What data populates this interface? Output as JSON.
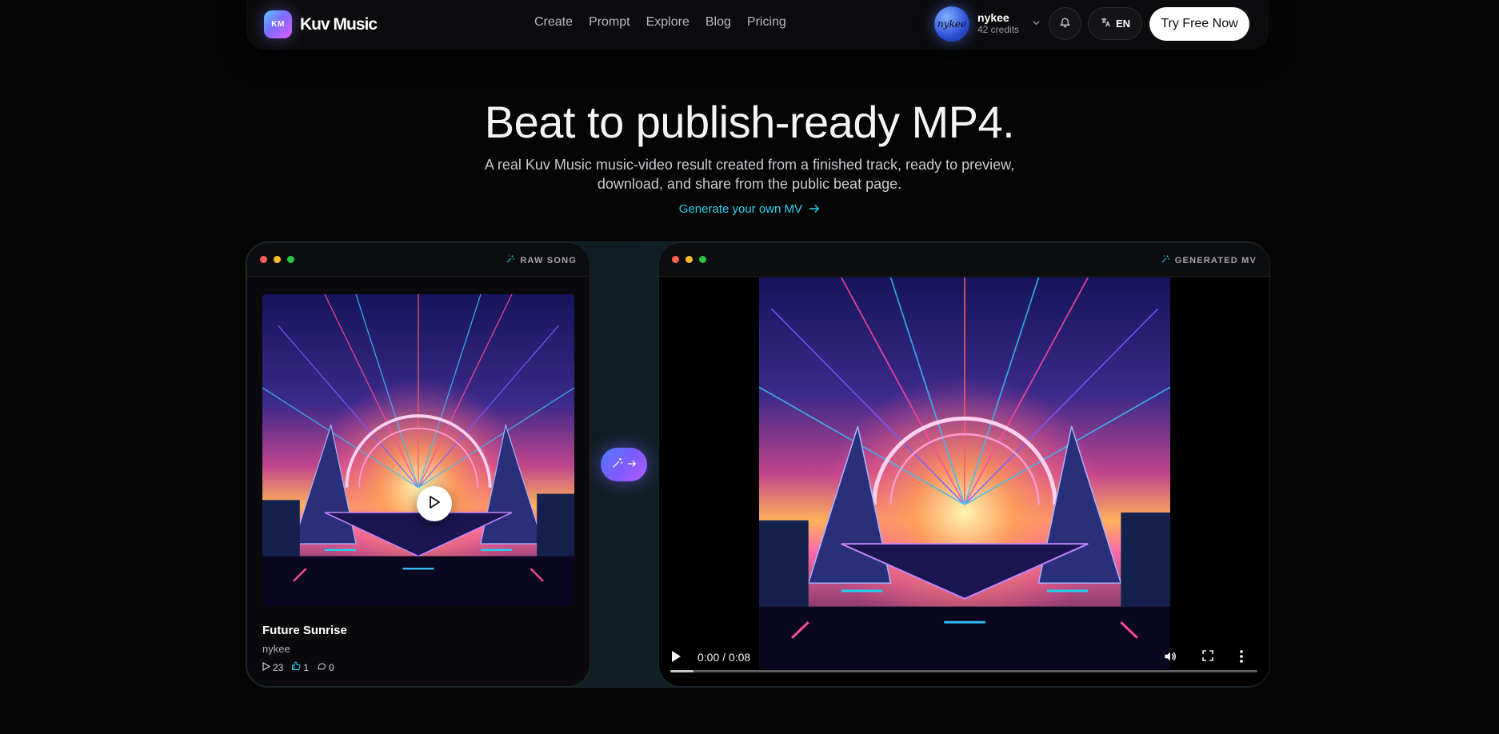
{
  "brand": {
    "logo_text": "KM",
    "name": "Kuv Music"
  },
  "nav": {
    "links": [
      "Create",
      "Prompt",
      "Explore",
      "Blog",
      "Pricing"
    ]
  },
  "user": {
    "avatar_text": "nykee",
    "name": "nykee",
    "credits": "42 credits"
  },
  "lang": {
    "label": "EN"
  },
  "cta": {
    "label": "Try Free Now"
  },
  "hero": {
    "title": "Beat to publish-ready MP4.",
    "subtitle": "A real Kuv Music music-video result created from a finished track, ready to preview, download, and share from the public beat page.",
    "link": "Generate your own MV"
  },
  "left_panel": {
    "tag": "RAW SONG",
    "song": {
      "title": "Future Sunrise",
      "artist": "nykee",
      "plays": "23",
      "likes": "1",
      "comments": "0"
    }
  },
  "right_panel": {
    "tag": "GENERATED MV",
    "video": {
      "time": "0:00 / 0:08",
      "progress": 0.04
    }
  },
  "colors": {
    "accent": "#27d3f0",
    "brand_gradient": [
      "#5cc8ff",
      "#7b6dff",
      "#e05cff"
    ]
  }
}
